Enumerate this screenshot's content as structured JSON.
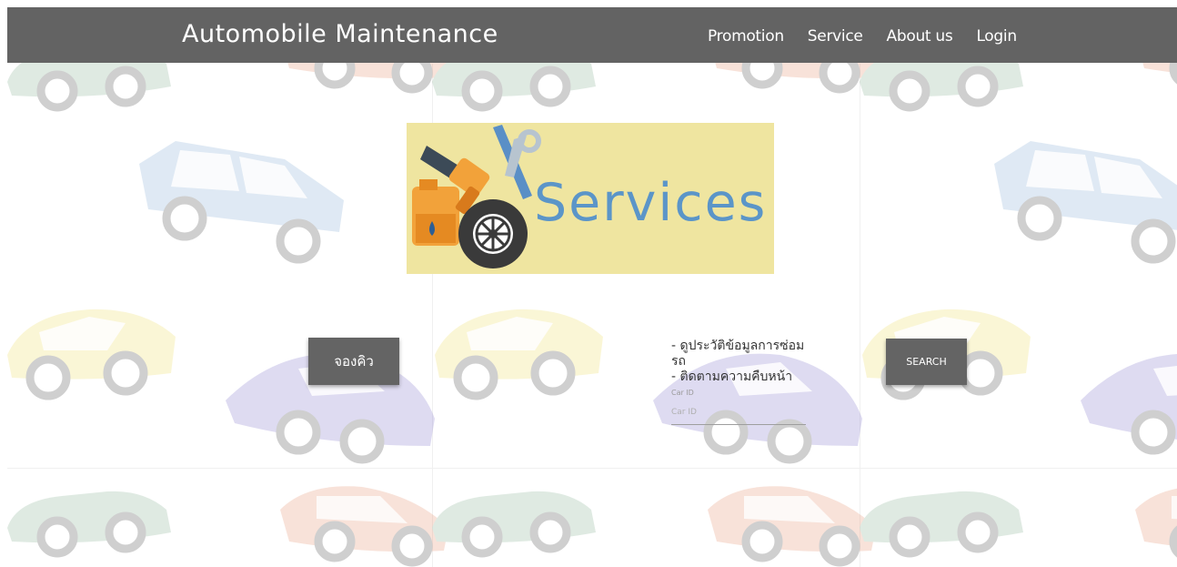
{
  "navbar": {
    "brand": "Automobile Maintenance",
    "links": [
      "Promotion",
      "Service",
      "About us",
      "Login"
    ]
  },
  "banner": {
    "title": "Services"
  },
  "booking": {
    "button_label": "จองคิว"
  },
  "tracking": {
    "line1": "- ดูประวัติข้อมูลการซ่อม",
    "line2": "รถ",
    "line3": "- ติดตามความคืบหน้า",
    "field_label": "Car ID",
    "field_placeholder": "Car ID",
    "search_label": "SEARCH"
  },
  "colors": {
    "navbar": "#636363",
    "banner_bg": "#efe5a0",
    "banner_text": "#5b95c8",
    "button": "#646464"
  }
}
